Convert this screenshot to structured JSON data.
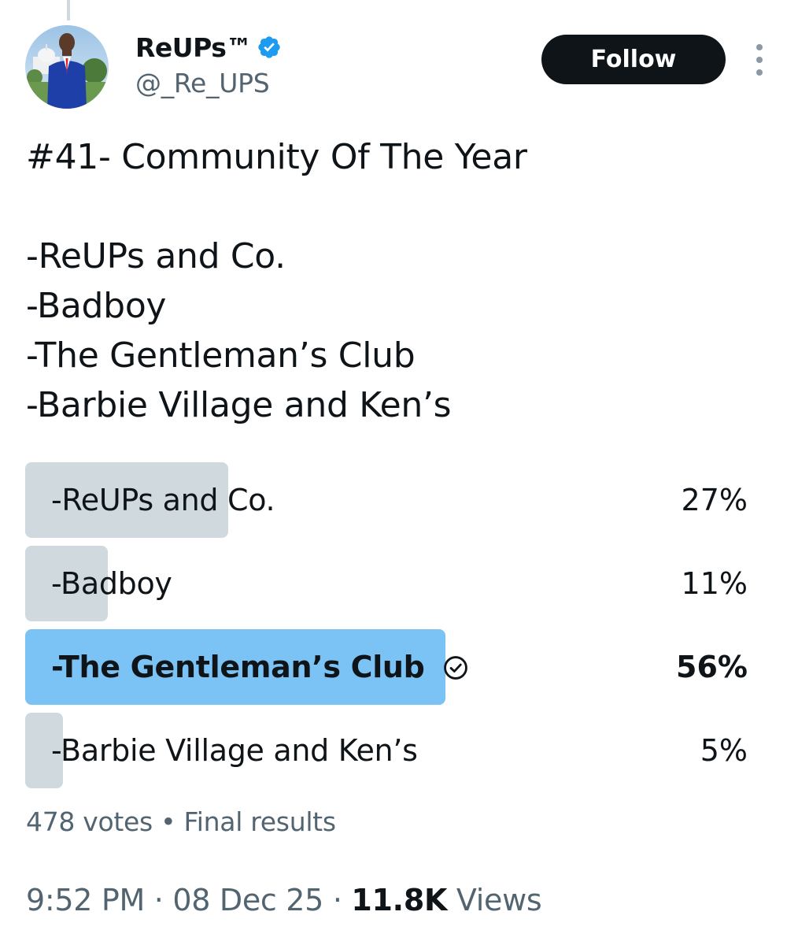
{
  "author": {
    "display_name": "ReUPs™",
    "handle": "@_Re_UPS",
    "verified": true,
    "verified_color": "#1d9bf0"
  },
  "follow_label": "Follow",
  "tweet": {
    "title": "#41- Community Of The Year",
    "lines": [
      "-ReUPs and Co.",
      "-Badboy",
      "-The Gentleman’s Club",
      "-Barbie Village and Ken’s"
    ]
  },
  "poll": {
    "options": [
      {
        "label": "-ReUPs and Co.",
        "percent_text": "27%",
        "percent": 27,
        "winner": false
      },
      {
        "label": "-Badboy",
        "percent_text": "11%",
        "percent": 11,
        "winner": false
      },
      {
        "label": "-The Gentleman’s Club",
        "percent_text": "56%",
        "percent": 56,
        "winner": true
      },
      {
        "label": "-Barbie Village and Ken’s",
        "percent_text": "5%",
        "percent": 5,
        "winner": false
      }
    ],
    "votes": "478 votes",
    "separator": "•",
    "status": "Final results",
    "bar_color": "#cfd9de",
    "winner_color": "#7cc3f5"
  },
  "meta": {
    "time": "9:52 PM",
    "dot": "·",
    "date": "08 Dec 25",
    "views_count": "11.8K",
    "views_label": "Views"
  }
}
